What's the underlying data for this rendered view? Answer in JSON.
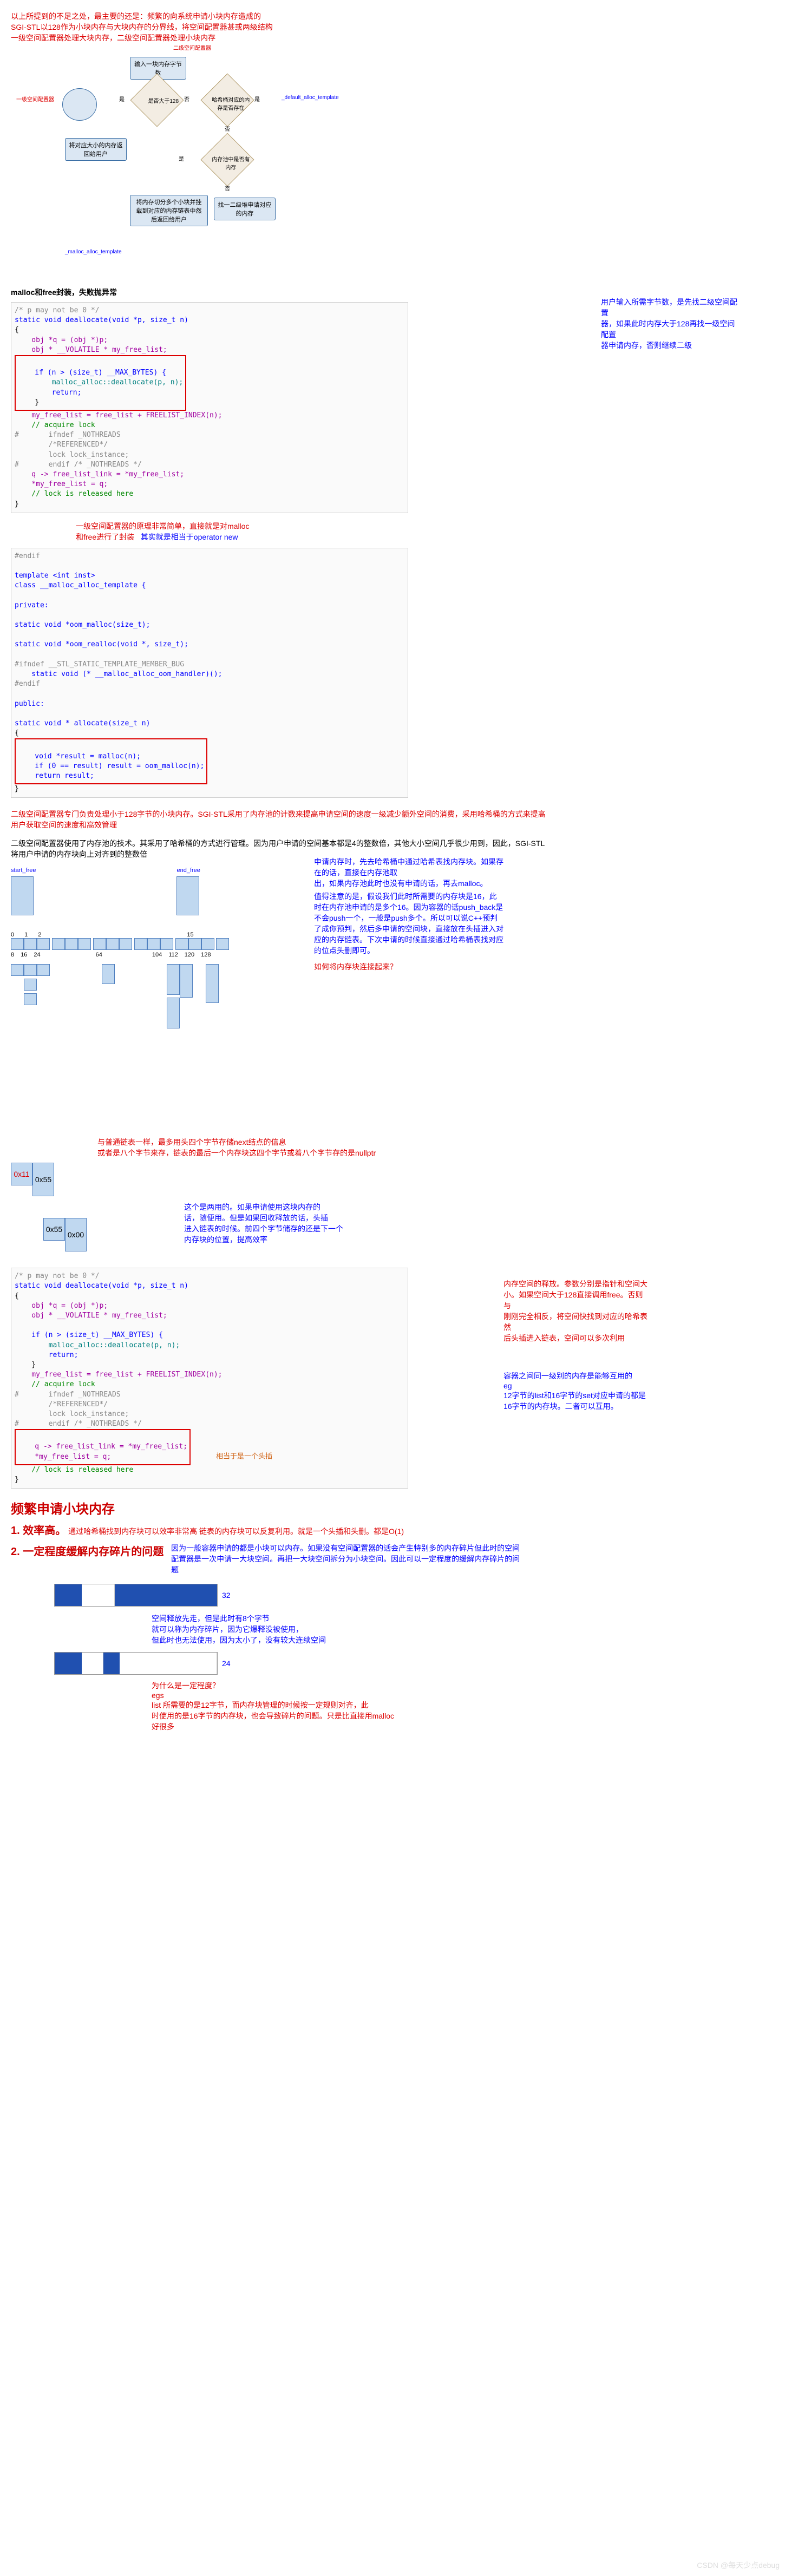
{
  "intro": {
    "line1": "以上所提到的不足之处，最主要的还是：频繁的向系统申请小块内存造成的",
    "line2": "SGI-STL以128作为小块内存与大块内存的分界线，将空间配置器甚或两级结构",
    "line3": "一级空间配置器处理大块内存，二级空间配置器处理小块内存"
  },
  "flowchart": {
    "title_right": "二级空间配置器",
    "input": "输入一块内存字节数",
    "l1_label": "一级空间配置器",
    "d1": "是否大于128",
    "yes": "是",
    "no": "否",
    "d2": "哈希桶对应的内存是否存在",
    "default_alloc": "_default_alloc_template",
    "ret_give": "将对应大小的内存返回给用户",
    "d3": "内存池中是否有内存",
    "split_mem": "将内存切分多个小块并挂载到对应的内存链表中然后返回给用户",
    "get_heap": "找一二级堆申请对应的内存",
    "malloc_alloc": "_malloc_alloc_template"
  },
  "section1_title": "malloc和free封装，失败抛异常",
  "right_note1": {
    "l1": "用户输入所需字节数，是先找二级空间配置",
    "l2": "器，如果此时内存大于128再找一级空间配置",
    "l3": "器申请内存，否则继续二级"
  },
  "code1": {
    "l01": "/* p may not be 0 */",
    "l02": "static void deallocate(void *p, size_t n)",
    "l03": "{",
    "l04": "    obj *q = (obj *)p;",
    "l05": "    obj * __VOLATILE * my_free_list;",
    "l06": "",
    "l07": "    if (n > (size_t) __MAX_BYTES) {",
    "l08": "        malloc_alloc::deallocate(p, n);",
    "l09": "        return;",
    "l10": "    }",
    "l11": "    my_free_list = free_list + FREELIST_INDEX(n);",
    "l12": "    // acquire lock",
    "l13": "#       ifndef _NOTHREADS",
    "l14": "        /*REFERENCED*/",
    "l15": "        lock lock_instance;",
    "l16": "#       endif /* _NOTHREADS */",
    "l17": "    q -> free_list_link = *my_free_list;",
    "l18": "    *my_free_list = q;",
    "l19": "    // lock is released here",
    "l20": "}"
  },
  "note_under_code1": {
    "l1": "一级空间配置器的原理非常简单，直接就是对malloc",
    "l2": "和free进行了封装",
    "l3": "其实就是相当于operator new"
  },
  "code2": {
    "l01": "#endif",
    "l02": "",
    "l03": "template <int inst>",
    "l04": "class __malloc_alloc_template {",
    "l05": "",
    "l06": "private:",
    "l07": "",
    "l08": "static void *oom_malloc(size_t);",
    "l09": "",
    "l10": "static void *oom_realloc(void *, size_t);",
    "l11": "",
    "l12": "#ifndef __STL_STATIC_TEMPLATE_MEMBER_BUG",
    "l13": "    static void (* __malloc_alloc_oom_handler)();",
    "l14": "#endif",
    "l15": "",
    "l16": "public:",
    "l17": "",
    "l18": "static void * allocate(size_t n)",
    "l19": "{",
    "l20": "    void *result = malloc(n);",
    "l21": "    if (0 == result) result = oom_malloc(n);",
    "l22": "    return result;",
    "l23": "}"
  },
  "section3": {
    "p1": "二级空间配置器专门负责处理小于128字节的小块内存。SGI-STL采用了内存池的计数来提高申请空间的速度一级减少额外空间的消费，采用哈希桶的方式来提高用户获取空间的速度和高效管理",
    "p2": "二级空间配置器使用了内存池的技术。其采用了哈希桶的方式进行管理。因为用户申请的空间基本都是4的整数倍，其他大小空间几乎很少用到，因此，SGI-STL将用户申请的内存块向上对齐到的整数倍"
  },
  "hash_note": {
    "l1": "申请内存时，先去哈希桶中通过哈希表找内存块。如果存在的话，直接在内存池取",
    "l2": "出，如果内存池此时也没有申请的话，再去malloc。",
    "l3": "值得注意的是，假设我们此时所需要的内存块是16，此时在内存池申请的是多个16。因为容器的话push_back是不会push一个，一般是push多个。所以可以说C++预判了成你预判，然后多申请的空间块，直接放在头插进入对应的内存链表。下次申请的时候直接通过哈希桶表找对应的位点头删即可。",
    "q": "如何将内存块连接起来？",
    "start_free": "start_free",
    "end_free": "end_free",
    "idx0": "0",
    "idx1": "1",
    "idx2": "2",
    "idx15": "15",
    "v8": "8",
    "v16": "16",
    "v24": "24",
    "v64": "64",
    "v104": "104",
    "v112": "112",
    "v120": "120",
    "v128": "128"
  },
  "link_note": {
    "l1": "与普通链表一样，最多用头四个字节存储next结点的信息",
    "l2": "或者是八个字节来存，链表的最后一个内存块这四个字节或着八个字节存的是nullptr",
    "node1a": "0x11",
    "node1b": "0x55",
    "node2a": "0x55",
    "node2b": "0x00"
  },
  "twouse_note": {
    "l1": "这个是两用的。如果申请使用这块内存的",
    "l2": "话，随便用。但是如果回收释放的话，头插",
    "l3": "进入链表的时候。前四个字节储存的还是下一个内存块的位置，提高效率"
  },
  "code3": {
    "l01": "/* p may not be 0 */",
    "l02": "static void deallocate(void *p, size_t n)",
    "l03": "{",
    "l04": "    obj *q = (obj *)p;",
    "l05": "    obj * __VOLATILE * my_free_list;",
    "l06": "",
    "l07": "    if (n > (size_t) __MAX_BYTES) {",
    "l08": "        malloc_alloc::deallocate(p, n);",
    "l09": "        return;",
    "l10": "    }",
    "l11": "    my_free_list = free_list + FREELIST_INDEX(n);",
    "l12": "    // acquire lock",
    "l13": "#       ifndef _NOTHREADS",
    "l14": "        /*REFERENCED*/",
    "l15": "        lock lock_instance;",
    "l16": "#       endif /* _NOTHREADS */",
    "l17": "    q -> free_list_link = *my_free_list;",
    "l18": "    *my_free_list = q;",
    "l19": "    // lock is released here",
    "l20": "}"
  },
  "release_note": {
    "l1": "内存空间的释放。参数分别是指针和空间大",
    "l2": "小。如果空间大于128直接调用free。否则与",
    "l3": "刚刚完全相反，将空间快找到对应的哈希表然",
    "l4": "后头插进入链表，空间可以多次利用",
    "sub1": "容器之间同一级别的内存是能够互用的",
    "sub2": "eg",
    "sub3": "12字节的list和16字节的set对应申请的都是16字节的内存块。二者可以互用。",
    "headins": "相当于是一个头插"
  },
  "freq_title": "频繁申请小块内存",
  "eff_title": "1. 效率高。",
  "eff_text": "通过哈希桶找到内存块可以效率非常高     链表的内存块可以反复利用。就是一个头插和头删。都是O(1)",
  "frag_title": "2. 一定程度缓解内存碎片的问题",
  "frag_text": "因为一般容器申请的都是小块可以内存。如果没有空间配置器的话会产生特别多的内存碎片但此时的空间配置器是一次申请一大块空间。再把一大块空间拆分为小块空间。因此可以一定程度的缓解内存碎片的问题",
  "frag_diagram": {
    "v32": "32",
    "v24": "24",
    "note1_l1": "空间释放先走，但是此时有8个字节",
    "note1_l2": "就可以称为内存碎片，因为它爆释没被使用，",
    "note1_l3": "但此时也无法使用，因为太小了，没有较大连续空间",
    "q": "为什么是一定程度？",
    "eg": "egs",
    "a1_l1": "list 所需要的是12字节，而内存块管理的时候按一定规则对齐，此",
    "a1_l2": "时使用的是16字节的内存块，也会导致碎片的问题。只是比直接用malloc好很多"
  },
  "watermark": "CSDN @每天少点debug"
}
